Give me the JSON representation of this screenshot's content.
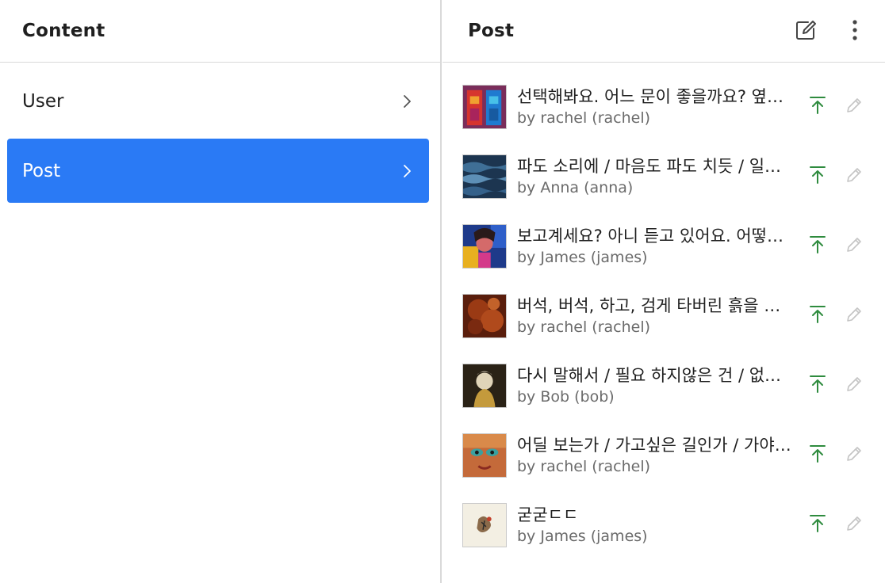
{
  "left": {
    "title": "Content",
    "items": [
      {
        "label": "User",
        "active": false
      },
      {
        "label": "Post",
        "active": true
      }
    ]
  },
  "right": {
    "title": "Post",
    "header_icons": [
      "edit-icon",
      "more-vertical-icon"
    ],
    "posts": [
      {
        "title": "선택해봐요. 어느 문이 좋을까요? 옆에 계신 분께 물어봐도 돼요",
        "author": "by rachel (rachel)"
      },
      {
        "title": "파도 소리에 / 마음도 파도 치듯 / 일렁인다",
        "author": "by Anna (anna)"
      },
      {
        "title": "보고계세요? 아니 듣고 있어요. 어떻게 듣고 계신가요",
        "author": "by James (james)"
      },
      {
        "title": "버석, 버석, 하고, 검게 타버린 흙을 밟는 소리",
        "author": "by rachel (rachel)"
      },
      {
        "title": "다시 말해서 / 필요 하지않은 건 / 없다는 것",
        "author": "by Bob (bob)"
      },
      {
        "title": "어딜 보는가 / 가고싶은 길인가 / 가야할 길인가",
        "author": "by rachel (rachel)"
      },
      {
        "title": "굳굳ㄷㄷ",
        "author": "by James (james)"
      }
    ],
    "row_icons": [
      "pin-to-top-icon",
      "pencil-icon"
    ]
  },
  "colors": {
    "accent": "#2a7af5",
    "pin_green": "#2e8b3e",
    "divider": "#d9d9d9",
    "muted": "#6b6b6b"
  }
}
